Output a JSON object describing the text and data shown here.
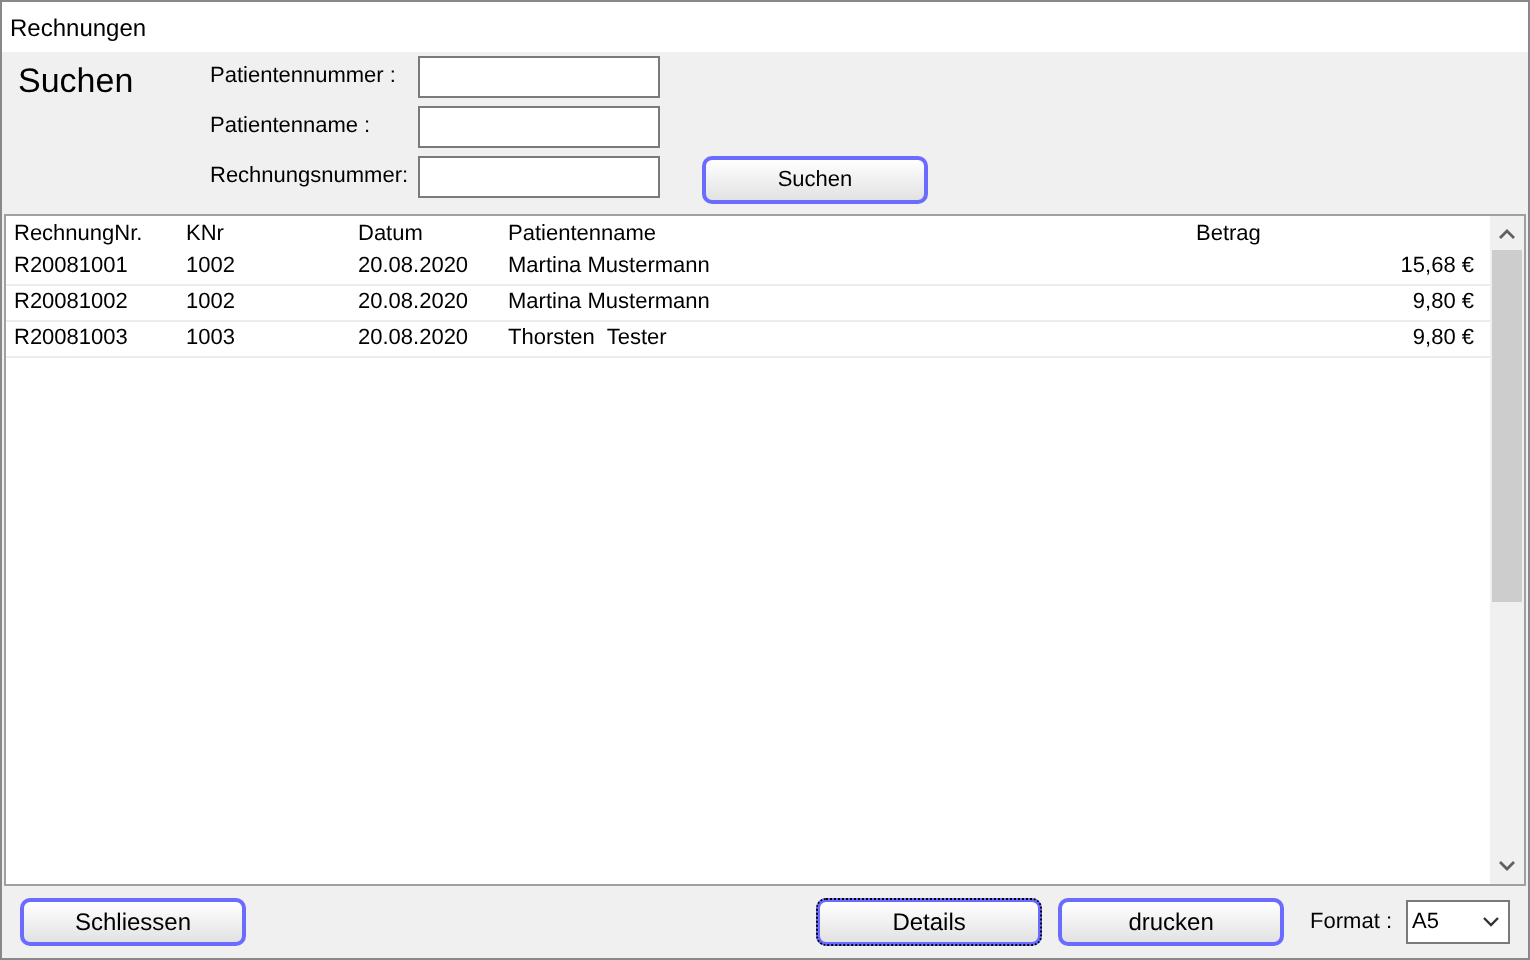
{
  "window": {
    "title": "Rechnungen"
  },
  "search": {
    "heading": "Suchen",
    "fields": [
      {
        "label": "Patientennummer :"
      },
      {
        "label": "Patientenname :"
      },
      {
        "label": "Rechnungsnummer:"
      }
    ],
    "button": "Suchen"
  },
  "table": {
    "columns": [
      "RechnungNr.",
      "KNr",
      "Datum",
      "Patientenname",
      "Betrag"
    ],
    "rows": [
      [
        "R20081001",
        "1002",
        "20.08.2020",
        "Martina Mustermann",
        "15,68 €"
      ],
      [
        "R20081002",
        "1002",
        "20.08.2020",
        "Martina Mustermann",
        "9,80 €"
      ],
      [
        "R20081003",
        "1003",
        "20.08.2020",
        "Thorsten  Tester",
        "9,80 €"
      ]
    ]
  },
  "footer": {
    "buttons": [
      {
        "label": "Schliessen",
        "focused": false
      },
      {
        "label": "Details",
        "focused": true
      },
      {
        "label": "drucken",
        "focused": false
      }
    ],
    "format_label": "Format :",
    "format_value": "A5"
  }
}
